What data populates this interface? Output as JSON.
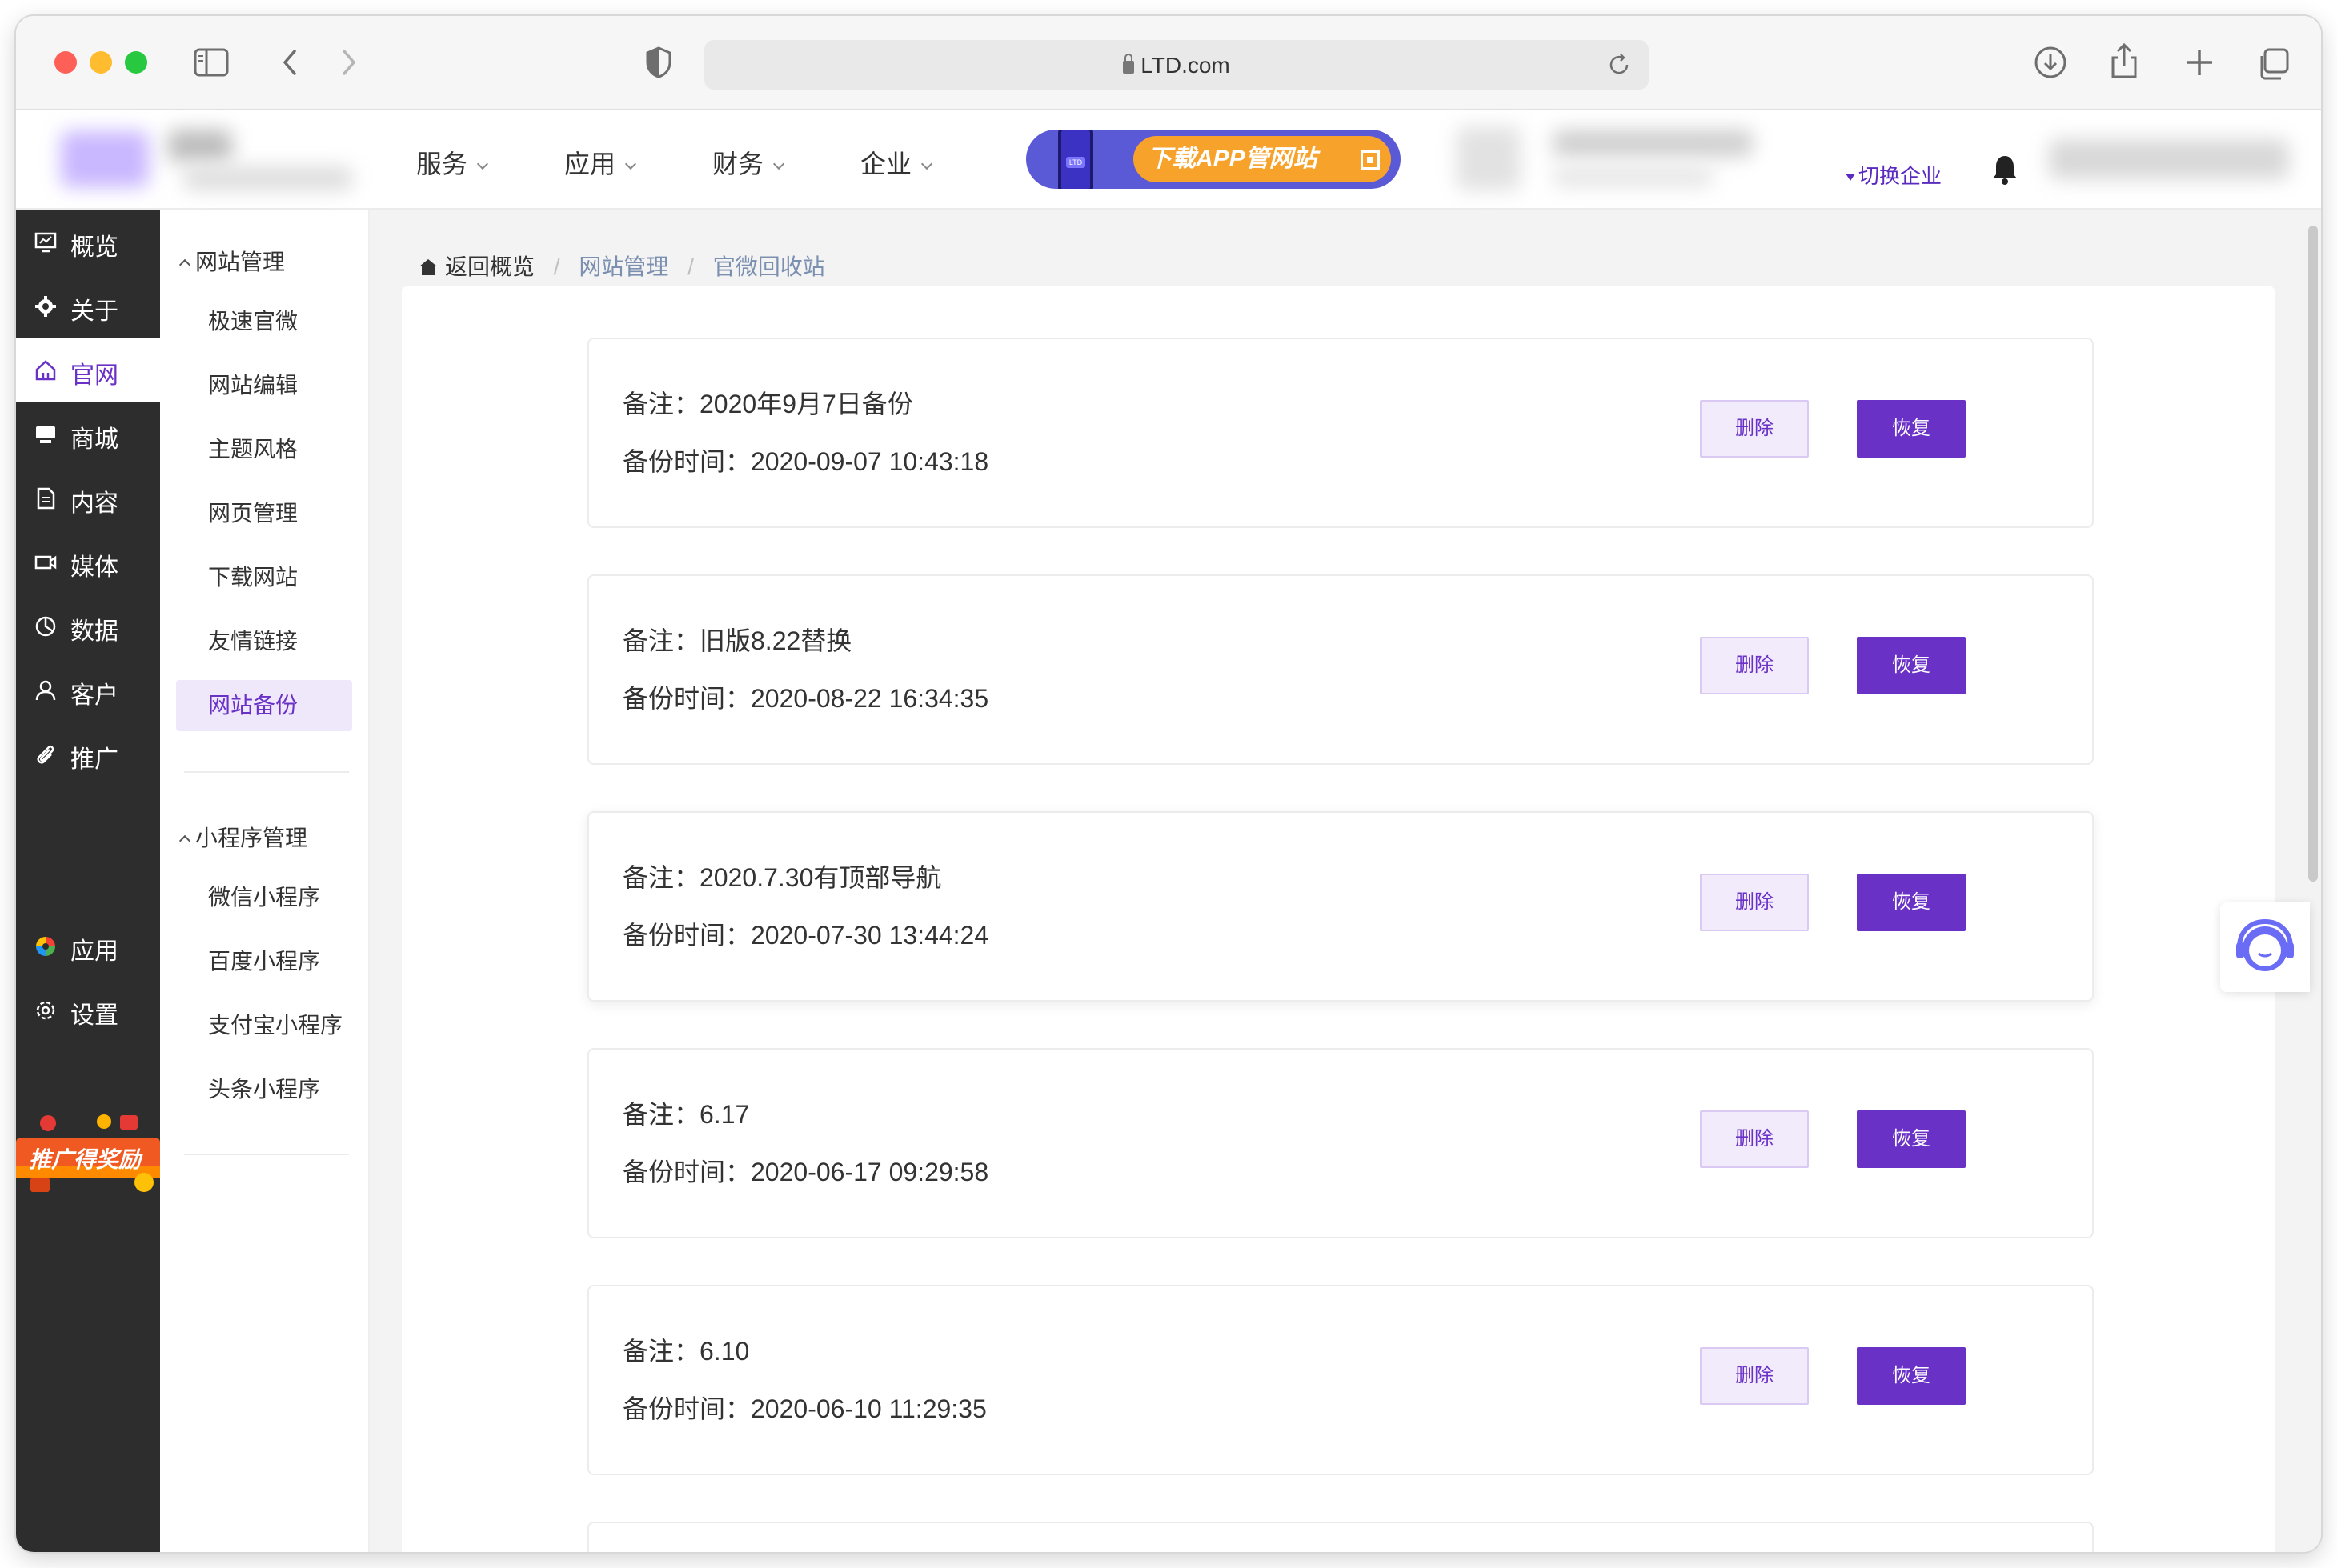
{
  "browser": {
    "url": "LTD.com"
  },
  "appnav": {
    "menus": [
      {
        "label": "服务"
      },
      {
        "label": "应用"
      },
      {
        "label": "财务"
      },
      {
        "label": "企业"
      }
    ],
    "promo_label": "下载APP管网站",
    "switch_label": "切换企业"
  },
  "sidenav": {
    "items": [
      {
        "label": "概览",
        "icon": "overview-icon"
      },
      {
        "label": "关于",
        "icon": "gear-icon"
      },
      {
        "label": "官网",
        "icon": "home-icon"
      },
      {
        "label": "商城",
        "icon": "shop-icon"
      },
      {
        "label": "内容",
        "icon": "document-icon"
      },
      {
        "label": "媒体",
        "icon": "video-icon"
      },
      {
        "label": "数据",
        "icon": "pie-chart-icon"
      },
      {
        "label": "客户",
        "icon": "user-icon"
      },
      {
        "label": "推广",
        "icon": "paperclip-icon"
      },
      {
        "label": "应用",
        "icon": "apps-icon"
      },
      {
        "label": "设置",
        "icon": "settings-icon"
      }
    ],
    "active": "官网",
    "reward_label": "推广得奖励"
  },
  "submenu": {
    "groups": [
      {
        "title": "网站管理",
        "items": [
          "极速官微",
          "网站编辑",
          "主题风格",
          "网页管理",
          "下载网站",
          "友情链接",
          "网站备份"
        ]
      },
      {
        "title": "小程序管理",
        "items": [
          "微信小程序",
          "百度小程序",
          "支付宝小程序",
          "头条小程序"
        ]
      }
    ],
    "active": "网站备份"
  },
  "breadcrumb": {
    "home": "返回概览",
    "level1": "网站管理",
    "level2": "官微回收站"
  },
  "backups": [
    {
      "note": "备注：2020年9月7日备份",
      "time": "备份时间：2020-09-07 10:43:18"
    },
    {
      "note": "备注：旧版8.22替换",
      "time": "备份时间：2020-08-22 16:34:35"
    },
    {
      "note": "备注：2020.7.30有顶部导航",
      "time": "备份时间：2020-07-30 13:44:24"
    },
    {
      "note": "备注：6.17",
      "time": "备份时间：2020-06-17 09:29:58"
    },
    {
      "note": "备注：6.10",
      "time": "备份时间：2020-06-10 11:29:35"
    }
  ],
  "buttons": {
    "delete": "删除",
    "restore": "恢复"
  },
  "colors": {
    "accent": "#6a31c7",
    "sidebar_bg": "#2d2d2d",
    "accent_light": "#efe8fb"
  }
}
